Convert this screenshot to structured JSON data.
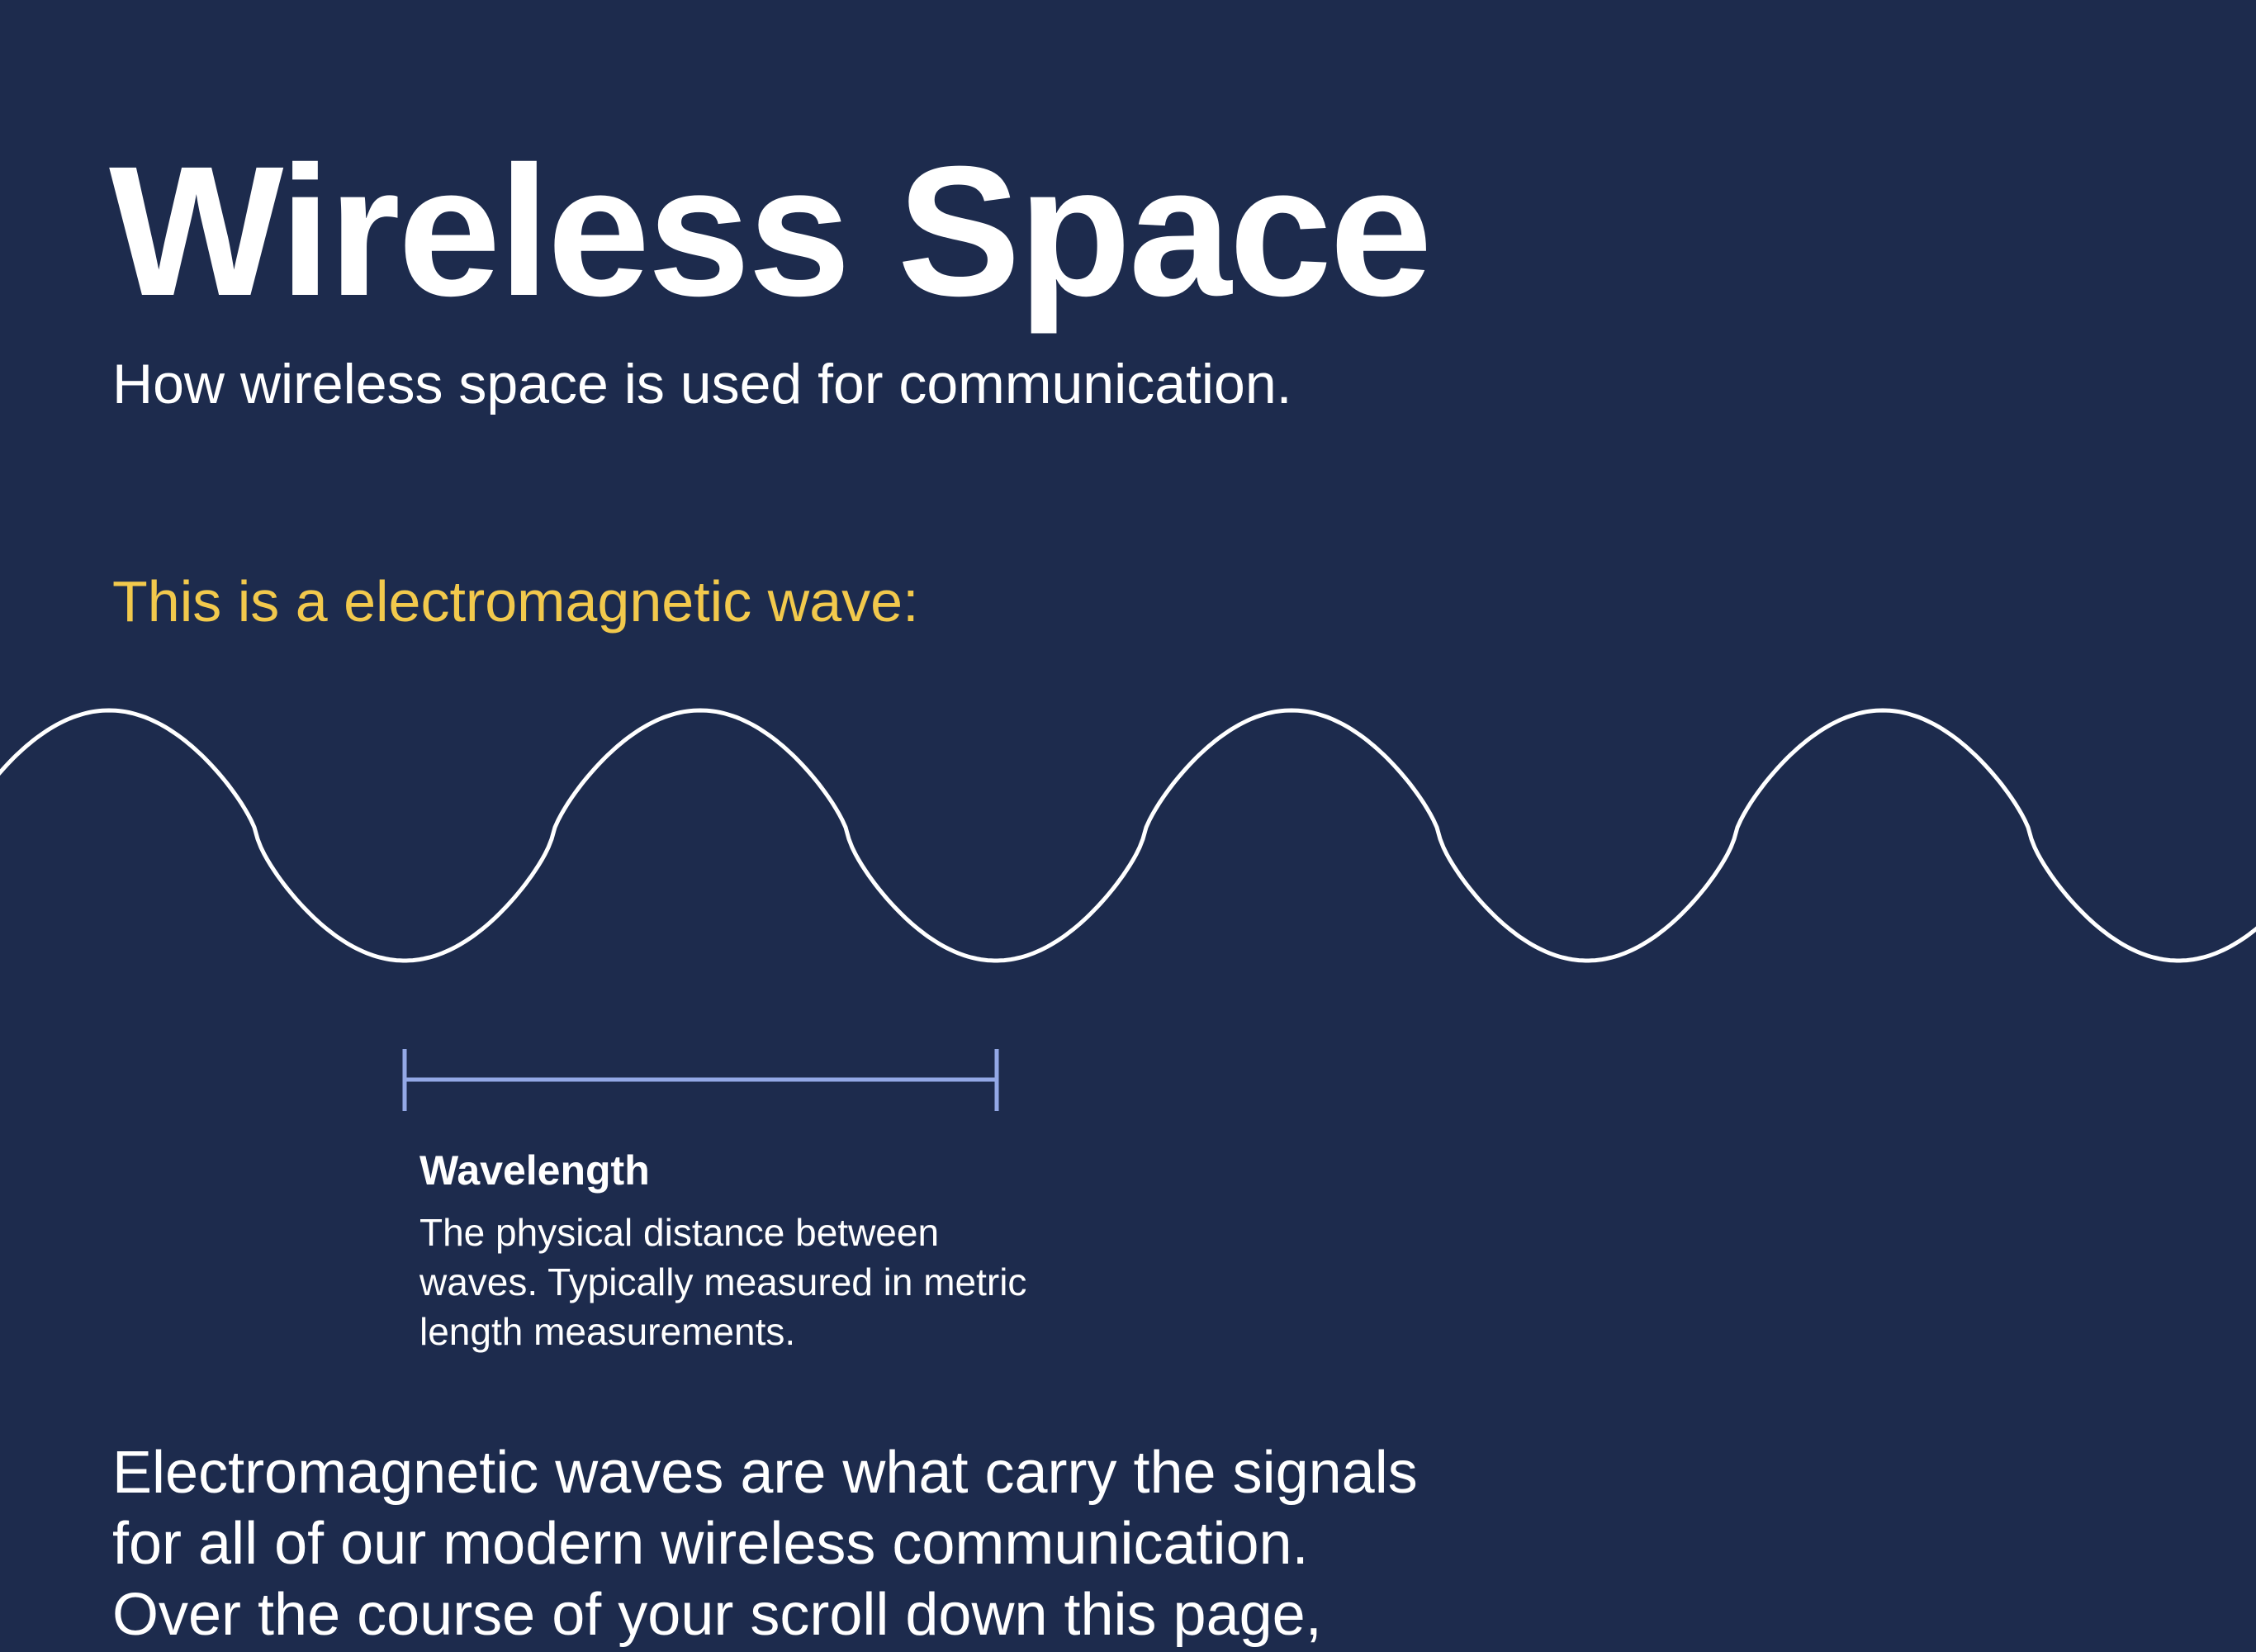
{
  "header": {
    "title": "Wireless Space",
    "subtitle": "How wireless space is used for communication."
  },
  "intro": {
    "wave_caption": "This is a electromagnetic wave:"
  },
  "wavelength": {
    "label": "Wavelength",
    "description": "The physical distance between waves. Typically measured in metric length measurements."
  },
  "body": {
    "lines": [
      "Electromagnetic waves are what carry the signals",
      "for all of our modern wireless communication.",
      "Over the course of your scroll down this page,"
    ]
  },
  "colors": {
    "background": "#1d2b4d",
    "text": "#ffffff",
    "accent": "#f2c94c",
    "wavelength_marker": "#93a8e6"
  }
}
